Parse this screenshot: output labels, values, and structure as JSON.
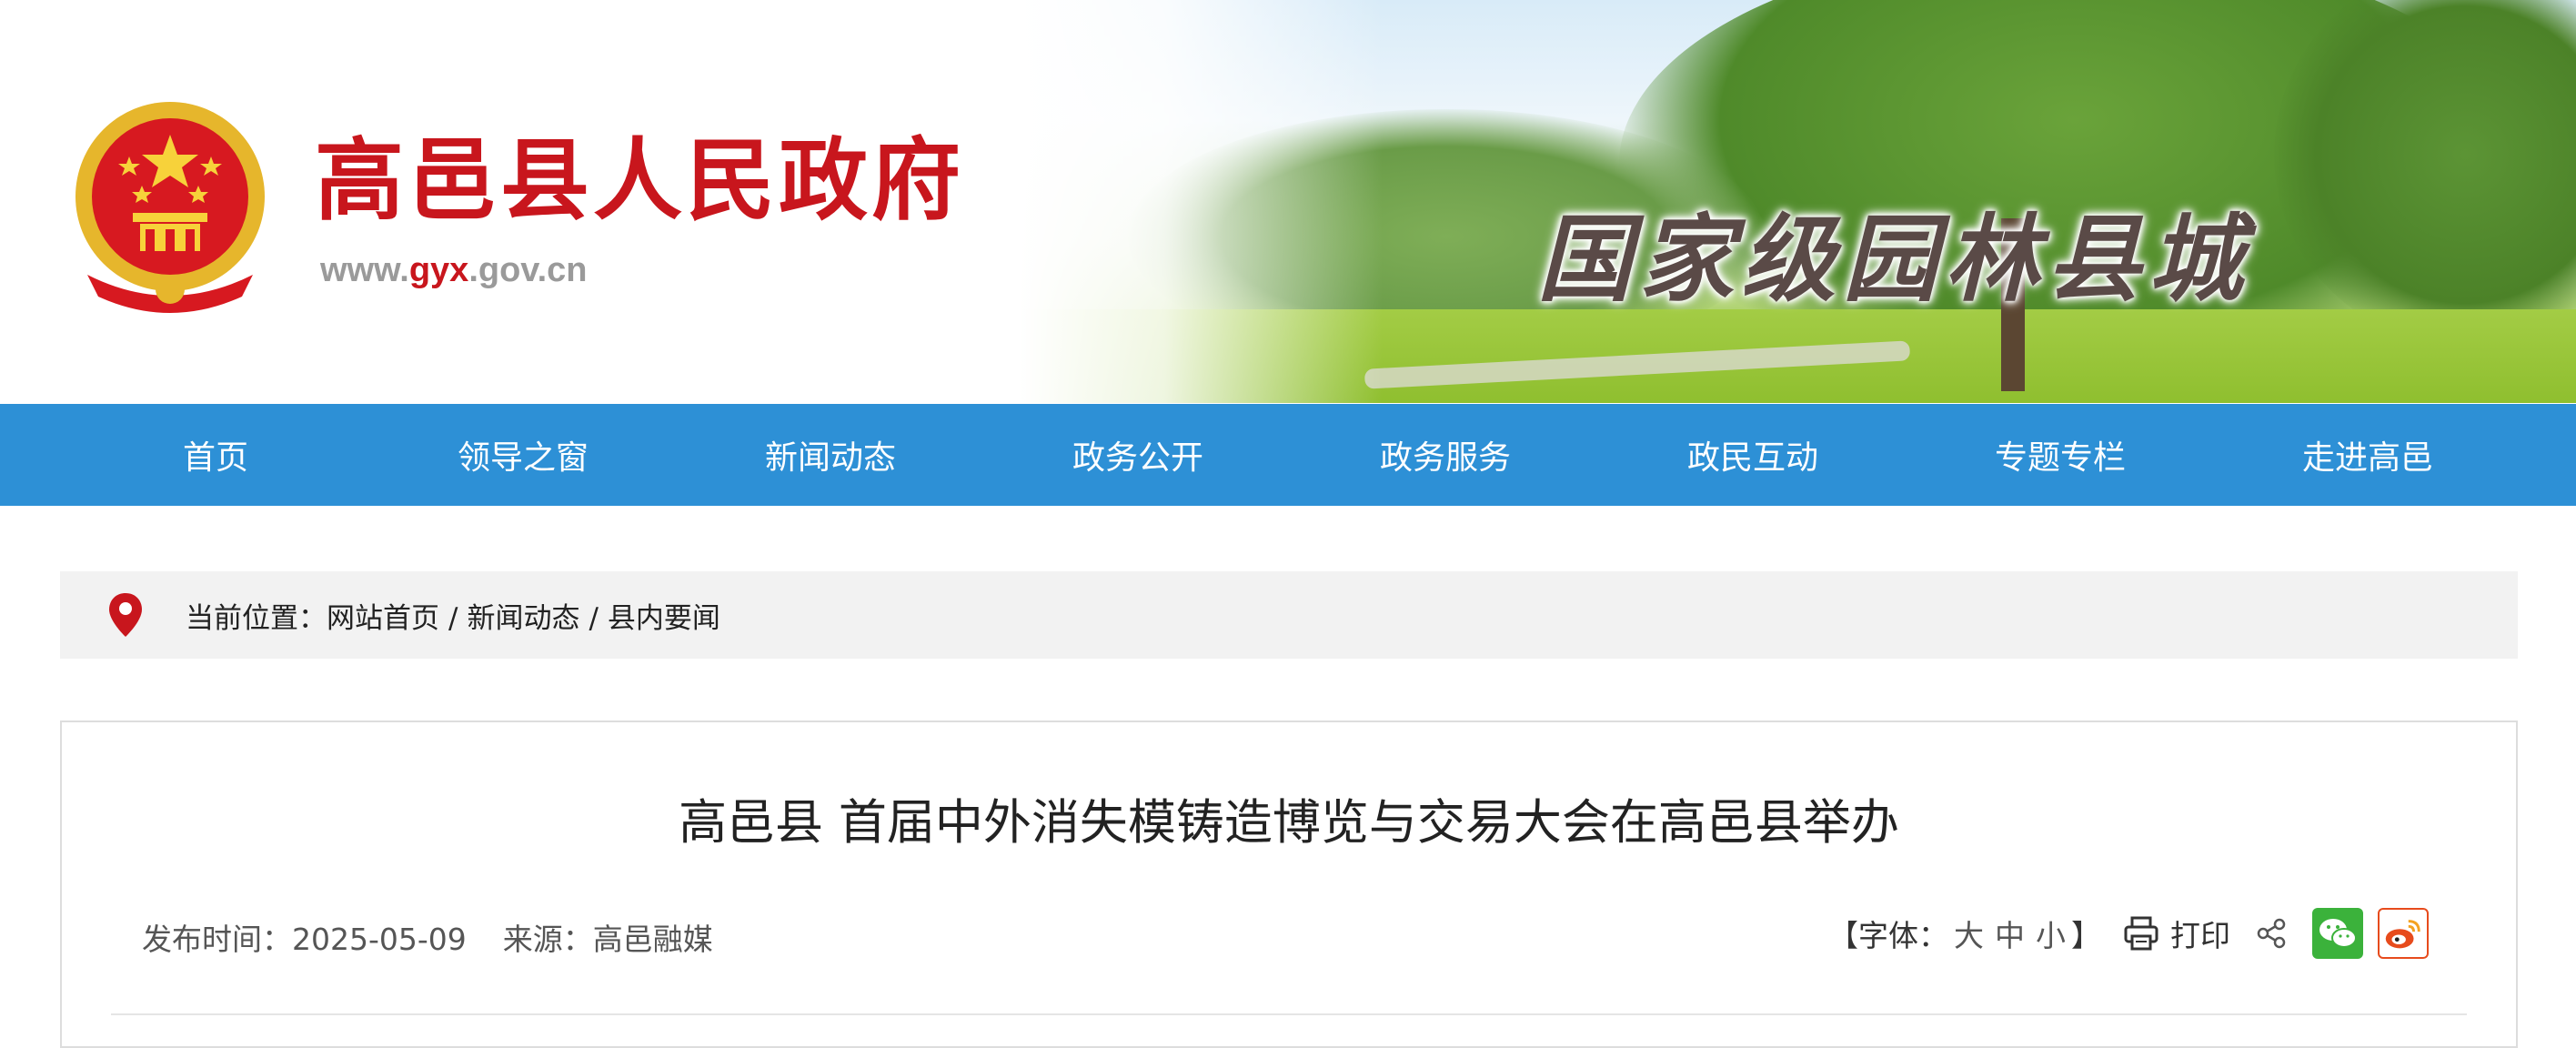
{
  "header": {
    "site_name": "高邑县人民政府",
    "url_prefix": "www.",
    "url_highlight": "gyx",
    "url_suffix": ".gov.cn",
    "slogan": "国家级园林县城"
  },
  "nav": {
    "items": [
      "首页",
      "领导之窗",
      "新闻动态",
      "政务公开",
      "政务服务",
      "政民互动",
      "专题专栏",
      "走进高邑"
    ]
  },
  "breadcrumb": {
    "prefix": "当前位置：",
    "items": [
      "网站首页",
      "新闻动态",
      "县内要闻"
    ],
    "separator": "/"
  },
  "article": {
    "title": "高邑县 首届中外消失模铸造博览与交易大会在高邑县举办",
    "publish_label": "发布时间：",
    "publish_date": "2025-05-09",
    "source_label": "来源：",
    "source": "高邑融媒"
  },
  "tools": {
    "font_label": "【字体：",
    "font_large": "大",
    "font_medium": "中",
    "font_small": "小",
    "font_close": "】",
    "print_label": "打印"
  },
  "colors": {
    "nav_bg": "#2d90d6",
    "brand_red": "#c8161d",
    "wechat_green": "#3bb23b",
    "weibo_orange": "#e74b1c"
  },
  "icons": [
    "national-emblem-icon",
    "location-pin-icon",
    "print-icon",
    "share-icon",
    "wechat-icon",
    "weibo-icon"
  ]
}
